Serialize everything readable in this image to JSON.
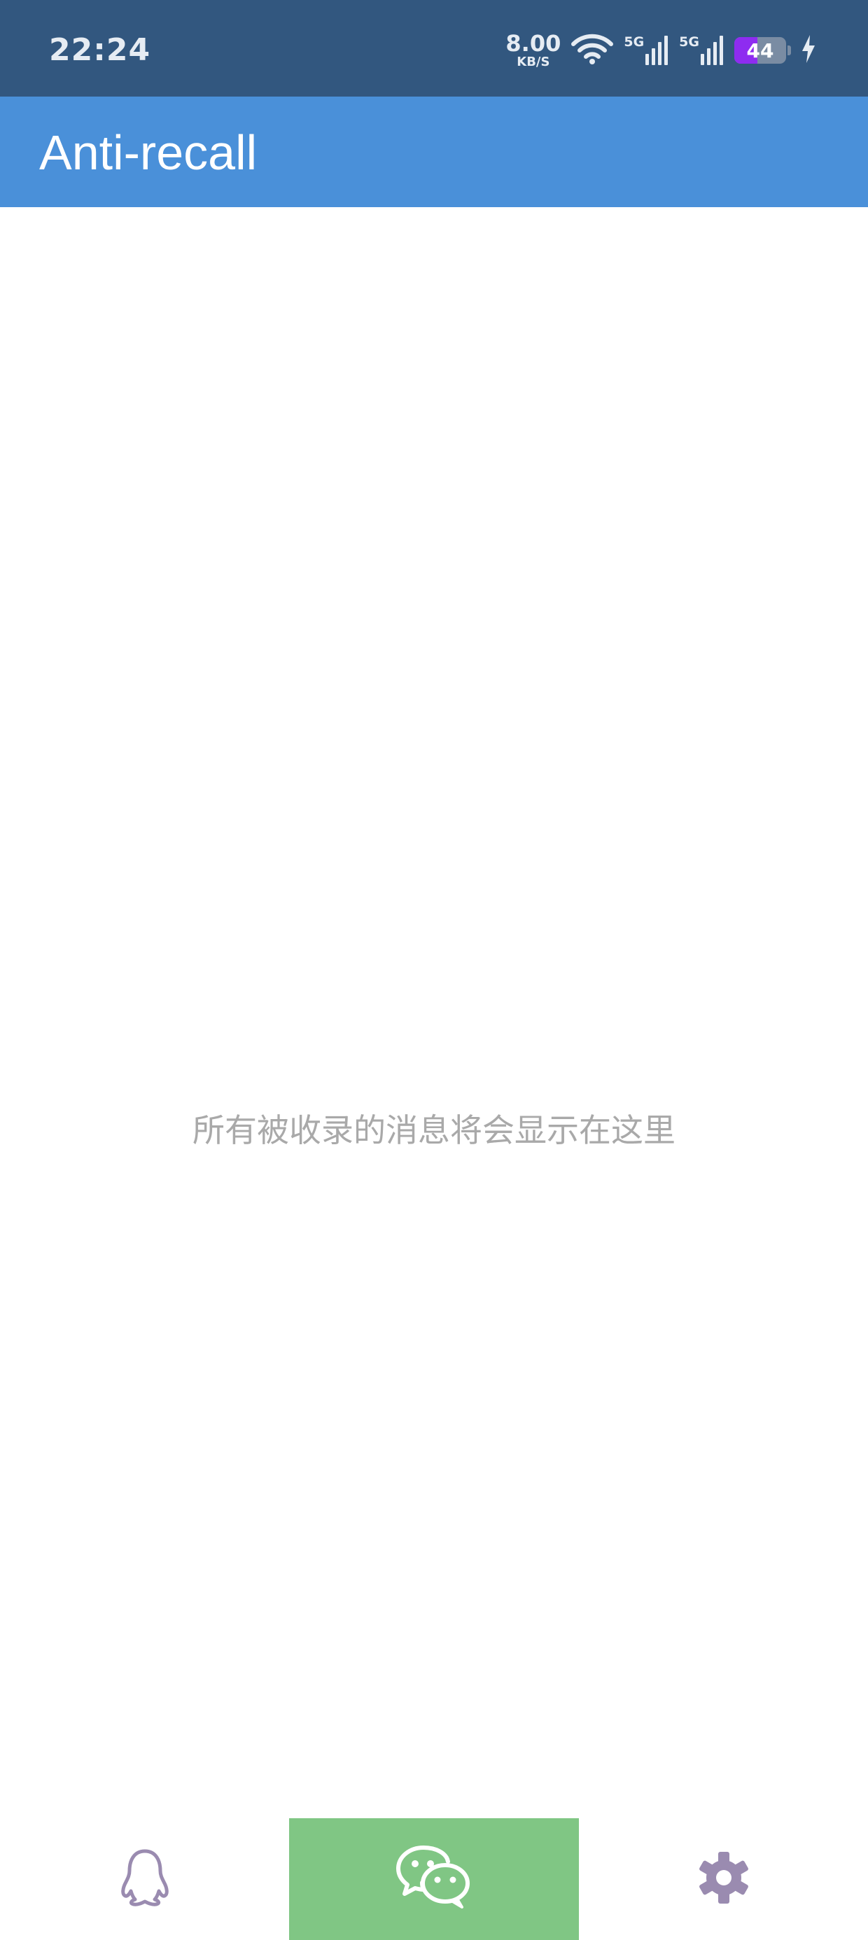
{
  "status_bar": {
    "time": "22:24",
    "net_speed_value": "8.00",
    "net_speed_unit": "KB/S",
    "sim1_label": "5G",
    "sim2_label": "5G",
    "battery_level": "44",
    "battery_fraction": 0.44
  },
  "app_bar": {
    "title": "Anti-recall"
  },
  "empty_state": {
    "message": "所有被收录的消息将会显示在这里"
  },
  "bottom_nav": {
    "tabs": [
      {
        "icon": "qq-penguin-icon",
        "active": false
      },
      {
        "icon": "wechat-icon",
        "active": true
      },
      {
        "icon": "gear-icon",
        "active": false
      }
    ]
  },
  "colors": {
    "status_bar": "#32577f",
    "app_bar": "#4a90d9",
    "active_tab": "#80c684",
    "icon_inactive": "#9a8bb0",
    "battery_fill": "#8e2cf0"
  }
}
